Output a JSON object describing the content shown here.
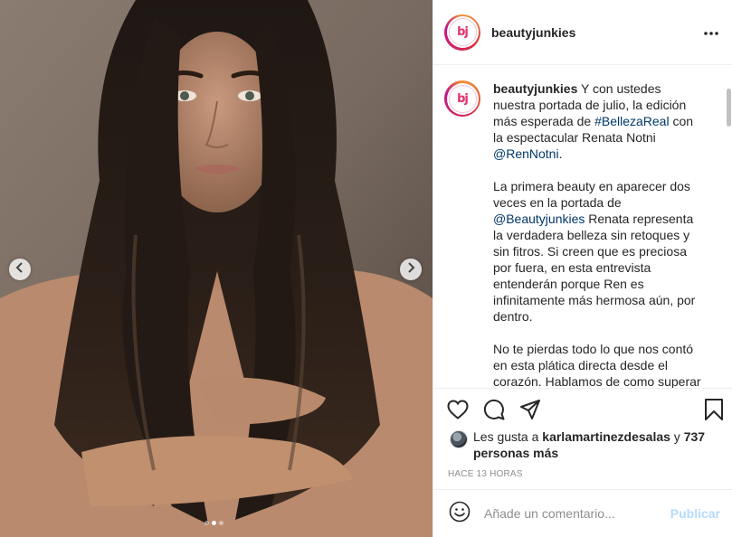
{
  "post": {
    "username": "beautyjunkies",
    "avatar_text": "bj",
    "caption": {
      "username": "beautyjunkies",
      "p1_text1": " Y con ustedes nuestra portada de julio, la edición más esperada de ",
      "p1_hashtag": "#BellezaReal",
      "p1_text2": " con la espectacular Renata Notni ",
      "p1_mention": "@RenNotni",
      "p1_end": ".",
      "p2_text1": "La primera beauty en aparecer dos veces en la portada de ",
      "p2_mention": "@Beautyjunkies",
      "p2_text2": " Renata representa la verdadera belleza sin retoques y sin fitros. Si creen que es preciosa por fuera, en esta entrevista entenderán porque Ren es infinitamente más hermosa aún, por dentro.",
      "p3_text": "No te pierdas todo lo que nos contó en esta plática directa desde el corazón. Hablamos de como superar sus miedos, la dualidad de la fama y mucho más."
    },
    "likes": {
      "prefix": "Les gusta a ",
      "user": "karlamartinezdesalas",
      "connector": " y ",
      "others": "737 personas más"
    },
    "timestamp": "Hace 13 horas",
    "comment_placeholder": "Añade un comentario...",
    "publish_label": "Publicar",
    "carousel": {
      "slide_count": 3,
      "active_index": 1
    }
  },
  "colors": {
    "text": "#262626",
    "link": "#00376b",
    "muted": "#8e8e8e",
    "publish_disabled": "#b3dbff",
    "border": "#efefef"
  },
  "icons": {
    "more": "more-icon",
    "like": "heart-icon",
    "comment": "comment-icon",
    "share": "share-icon",
    "save": "bookmark-icon",
    "emoji": "emoji-icon",
    "prev": "chevron-left-icon",
    "next": "chevron-right-icon"
  }
}
